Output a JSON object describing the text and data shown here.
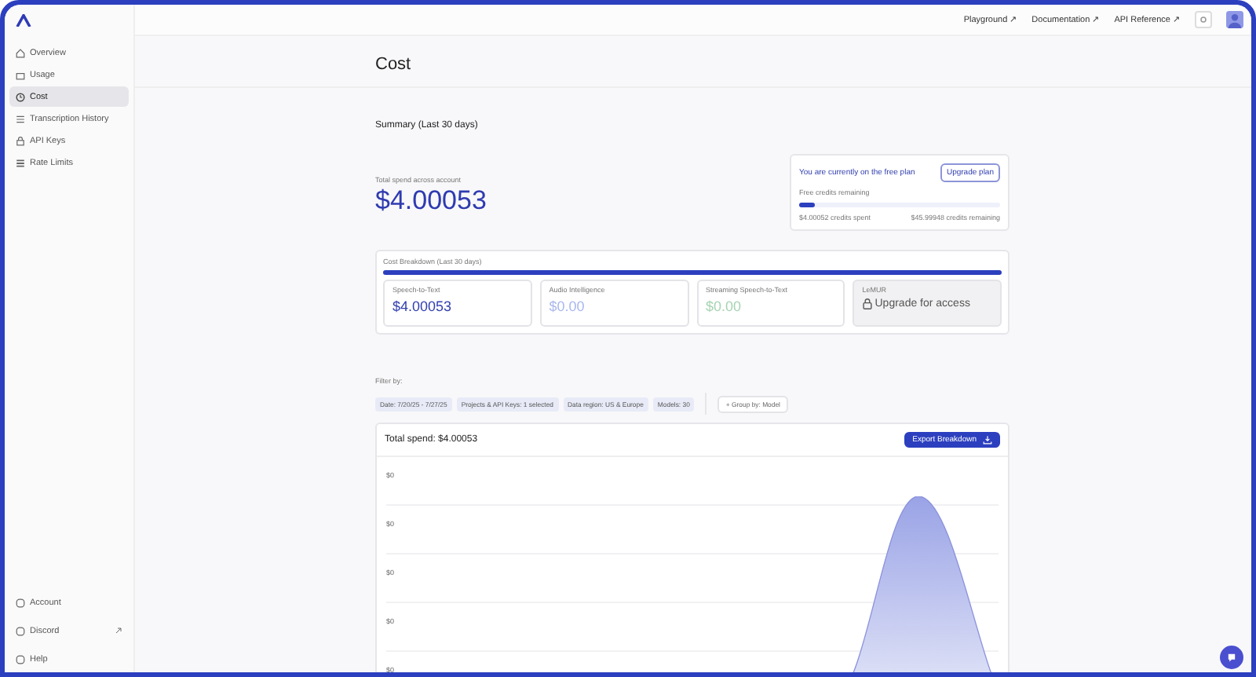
{
  "top_links": [
    {
      "label": "Playground ↗"
    },
    {
      "label": "Documentation ↗"
    },
    {
      "label": "API Reference ↗"
    }
  ],
  "sidebar": {
    "items": [
      {
        "label": "Overview",
        "selected": false
      },
      {
        "label": "Usage",
        "selected": false
      },
      {
        "label": "Cost",
        "selected": true
      },
      {
        "label": "Transcription History",
        "selected": false
      },
      {
        "label": "API Keys",
        "selected": false
      },
      {
        "label": "Rate Limits",
        "selected": false
      }
    ],
    "bottom_items": [
      {
        "label": "Account",
        "external": false
      },
      {
        "label": "Discord",
        "external": true
      },
      {
        "label": "Help",
        "external": false
      }
    ]
  },
  "page_title": "Cost",
  "summary": {
    "heading": "Summary (Last 30 days)",
    "total_label": "Total spend across account",
    "total_value": "$4.00053"
  },
  "plan": {
    "message": "You are currently on the free plan",
    "button": "Upgrade plan",
    "credits_label": "Free credits remaining",
    "level": 0.08,
    "spent": "$4.00052 credits spent",
    "remaining": "$45.99948 credits remaining"
  },
  "breakdown": {
    "title": "Cost Breakdown (Last 30 days)",
    "cards": [
      {
        "kind": "amount",
        "label": "Speech-to-Text",
        "value": "$4.00053",
        "color": "#3340b0"
      },
      {
        "kind": "amount",
        "label": "Audio Intelligence",
        "value": "$0.00",
        "color": "#a9b8ee"
      },
      {
        "kind": "amount",
        "label": "Streaming Speech-to-Text",
        "value": "$0.00",
        "color": "#a6d4b2"
      },
      {
        "kind": "locked",
        "label": "LeMUR",
        "value": "Upgrade for access"
      }
    ]
  },
  "filters": {
    "label": "Filter by:",
    "chips": [
      "Date: 7/20/25 - 7/27/25",
      "Projects & API Keys: 1 selected",
      "Data region: US & Europe",
      "Models: 30"
    ],
    "group_by": "+ Group by: Model"
  },
  "chart_panel": {
    "title": "Total spend: $4.00053",
    "export_button": "Export Breakdown",
    "y_tick_labels": [
      "$0",
      "$0",
      "$0",
      "$0",
      "$0"
    ]
  }
}
